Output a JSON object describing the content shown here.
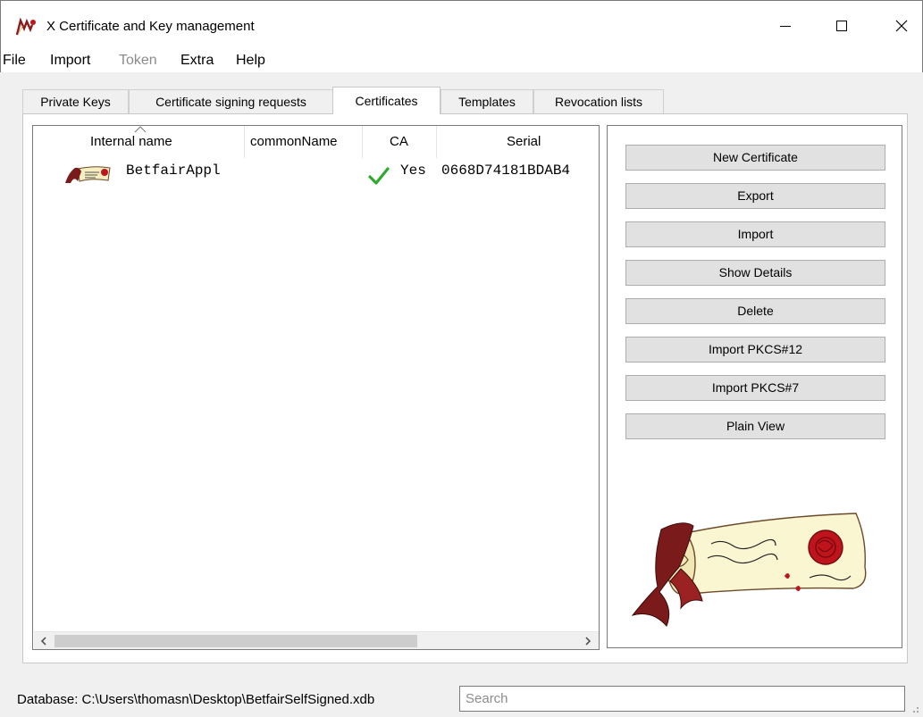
{
  "window": {
    "title": "X Certificate and Key management",
    "controls": [
      "minimize",
      "maximize",
      "close"
    ]
  },
  "menu": [
    {
      "label": "File",
      "enabled": true
    },
    {
      "label": "Import",
      "enabled": true
    },
    {
      "label": "Token",
      "enabled": false
    },
    {
      "label": "Extra",
      "enabled": true
    },
    {
      "label": "Help",
      "enabled": true
    }
  ],
  "tabs": [
    {
      "label": "Private Keys",
      "active": false
    },
    {
      "label": "Certificate signing requests",
      "active": false
    },
    {
      "label": "Certificates",
      "active": true
    },
    {
      "label": "Templates",
      "active": false
    },
    {
      "label": "Revocation lists",
      "active": false
    }
  ],
  "table": {
    "columns": [
      "Internal name",
      "commonName",
      "CA",
      "Serial"
    ],
    "sort_column": "Internal name",
    "rows": [
      {
        "internal_name": "BetfairAppl",
        "common_name": "",
        "ca": "Yes",
        "ca_check": true,
        "serial": "0668D74181BDAB4"
      }
    ]
  },
  "actions": [
    "New Certificate",
    "Export",
    "Import",
    "Show Details",
    "Delete",
    "Import PKCS#12",
    "Import PKCS#7",
    "Plain View"
  ],
  "status": {
    "database": "Database: C:\\Users\\thomasn\\Desktop\\BetfairSelfSigned.xdb"
  },
  "search": {
    "placeholder": "Search",
    "value": ""
  },
  "colors": {
    "check": "#2eaa2e",
    "ribbon": "#7a1a1a",
    "seal": "#c0141c",
    "scroll_paper": "#fbf6d2"
  }
}
